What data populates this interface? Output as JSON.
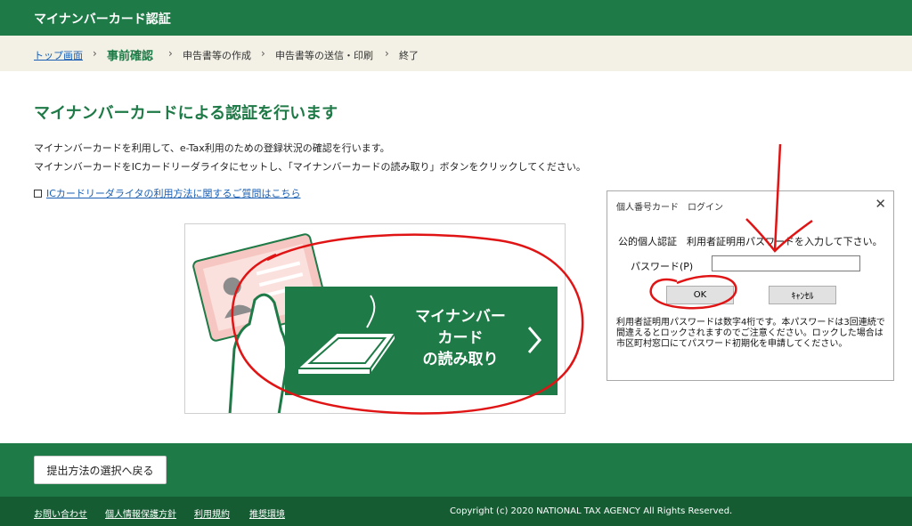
{
  "header": {
    "title": "マイナンバーカード認証"
  },
  "breadcrumb": {
    "items": [
      {
        "label": "トップ画面"
      },
      {
        "label": "事前確認"
      },
      {
        "label": "申告書等の作成"
      },
      {
        "label": "申告書等の送信・印刷"
      },
      {
        "label": "終了"
      }
    ],
    "separator": "›"
  },
  "main": {
    "heading": "マイナンバーカードによる認証を行います",
    "description_line1": "マイナンバーカードを利用して、e-Tax利用のための登録状況の確認を行います。",
    "description_line2": "マイナンバーカードをICカードリーダライタにセットし、「マイナンバーカードの読み取り」ボタンをクリックしてください。",
    "help_link": "ICカードリーダライタの利用方法に関するご質問はこちら",
    "read_button_lines": [
      "マイナンバー",
      "カード",
      "の読み取り"
    ]
  },
  "dialog": {
    "title": "個人番号カード　ログイン",
    "close": "✕",
    "prompt": "公的個人認証　利用者証明用パスワードを入力して下さい。",
    "password_label": "パスワード(P)",
    "password_value": "",
    "ok_label": "OK",
    "cancel_label": "ｷｬﾝｾﾙ",
    "note": "利用者証明用パスワードは数字4桁です。本パスワードは3回連続で間違えるとロックされますのでご注意ください。ロックした場合は市区町村窓口にてパスワード初期化を申請してください。"
  },
  "bottom": {
    "back_button": "提出方法の選択へ戻る"
  },
  "footer": {
    "links": [
      "お問い合わせ",
      "個人情報保護方針",
      "利用規約",
      "推奨環境"
    ],
    "copyright": "Copyright (c) 2020 NATIONAL TAX AGENCY All Rights Reserved."
  },
  "colors": {
    "brand_green": "#1e7a46",
    "footer_green": "#155c33",
    "breadcrumb_bg": "#f3f1e6",
    "annotation_red": "#e01414"
  }
}
